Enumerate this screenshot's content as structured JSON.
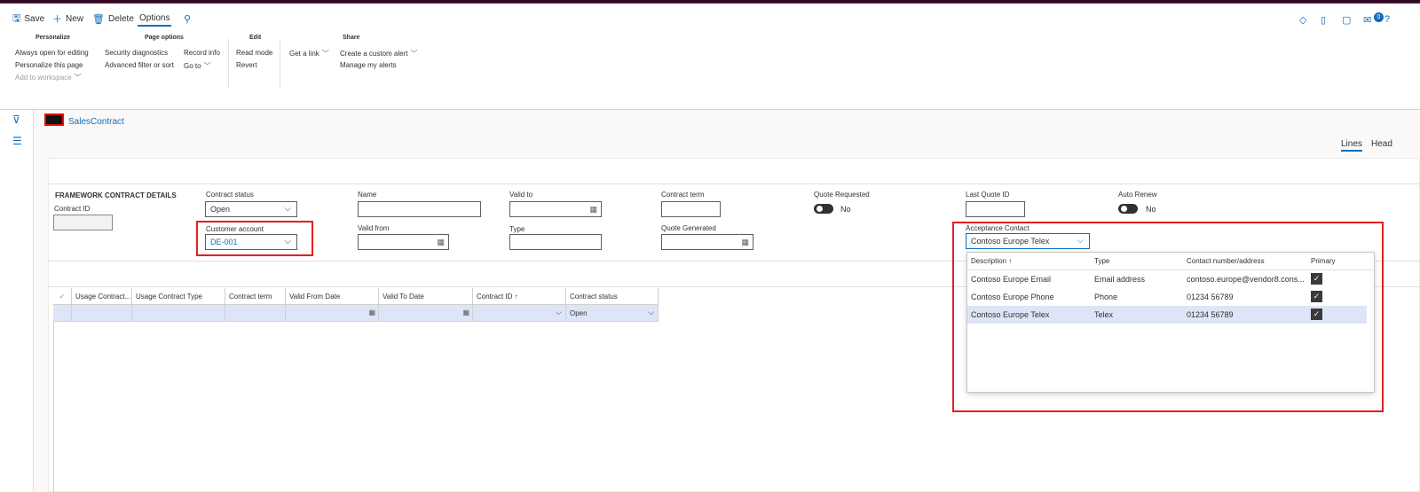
{
  "actionbar": {
    "save": "Save",
    "new": "New",
    "delete": "Delete",
    "options": "Options",
    "notification_count": "0"
  },
  "ribbon": {
    "personalize": {
      "title": "Personalize",
      "always_open": "Always open for editing",
      "personalize_page": "Personalize this page",
      "add_workspace": "Add to workspace"
    },
    "page_options": {
      "title": "Page options",
      "security": "Security diagnostics",
      "advanced_filter": "Advanced filter or sort",
      "record_info": "Record info",
      "go_to": "Go to"
    },
    "edit": {
      "title": "Edit",
      "read_mode": "Read mode",
      "revert": "Revert"
    },
    "link": {
      "get_link": "Get a link"
    },
    "share": {
      "title": "Share",
      "custom_alert": "Create a custom alert",
      "manage_alerts": "Manage my alerts"
    }
  },
  "page": {
    "caption": "SalesContract",
    "tab_lines": "Lines",
    "tab_header": "Head"
  },
  "details": {
    "section_title": "FRAMEWORK CONTRACT DETAILS",
    "contract_id_label": "Contract ID",
    "contract_status_label": "Contract status",
    "contract_status_value": "Open",
    "customer_account_label": "Customer account",
    "customer_account_value": "DE-001",
    "name_label": "Name",
    "valid_from_label": "Valid from",
    "valid_to_label": "Valid to",
    "type_label": "Type",
    "contract_term_label": "Contract term",
    "quote_generated_label": "Quote Generated",
    "quote_requested_label": "Quote Requested",
    "quote_requested_value": "No",
    "last_quote_id_label": "Last Quote ID",
    "auto_renew_label": "Auto Renew",
    "auto_renew_value": "No",
    "acceptance_contact_label": "Acceptance Contact",
    "acceptance_contact_value": "Contoso Europe Telex"
  },
  "grid": {
    "columns": [
      "Usage Contract...",
      "Usage Contract Type",
      "Contract term",
      "Valid From Date",
      "Valid To Date",
      "Contract ID",
      "Contract status"
    ],
    "contract_id_sort": "↑",
    "row_status": "Open"
  },
  "lookup": {
    "headers": {
      "description": "Description",
      "sort": "↑",
      "type": "Type",
      "contact": "Contact number/address",
      "primary": "Primary"
    },
    "rows": [
      {
        "description": "Contoso Europe Email",
        "type": "Email address",
        "contact": "contoso.europe@vendor8.cons..."
      },
      {
        "description": "Contoso Europe Phone",
        "type": "Phone",
        "contact": "01234 56789"
      },
      {
        "description": "Contoso Europe Telex",
        "type": "Telex",
        "contact": "01234 56789"
      }
    ]
  },
  "icons": {
    "save": "save-icon",
    "new": "plus-icon",
    "delete": "trash-icon",
    "search": "search-icon",
    "filter": "filter-icon",
    "menu": "hamburger-icon",
    "calendar": "calendar-icon",
    "chevron": "chevron-down-icon"
  },
  "colors": {
    "accent": "#0f6cbd",
    "highlight_box": "#e02020",
    "selected_row": "#dce6f7"
  }
}
